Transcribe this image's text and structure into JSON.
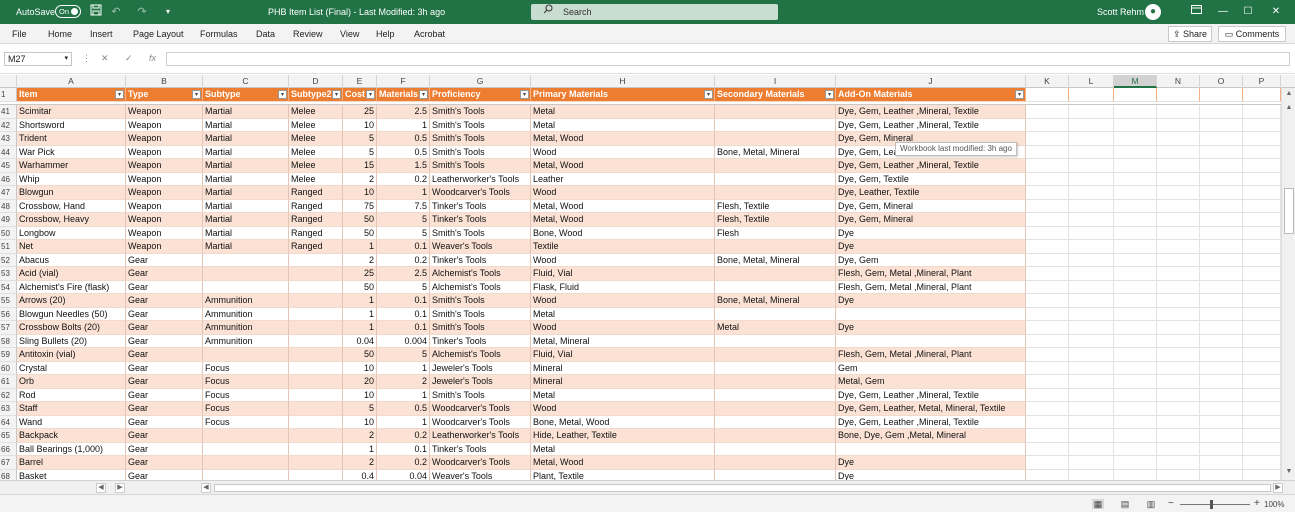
{
  "titlebar": {
    "autosave_label": "AutoSave",
    "autosave_state": "On",
    "title": "PHB Item List (Final)  -  Last Modified: 3h ago",
    "search_placeholder": "Search",
    "user_name": "Scott Rehm"
  },
  "ribbon": {
    "tabs": [
      "File",
      "Home",
      "Insert",
      "Page Layout",
      "Formulas",
      "Data",
      "Review",
      "View",
      "Help",
      "Acrobat"
    ],
    "share_label": "Share",
    "comments_label": "Comments"
  },
  "formula_bar": {
    "name_box": "M27",
    "fx_label": "fx",
    "value": ""
  },
  "columns": [
    "A",
    "B",
    "C",
    "D",
    "E",
    "F",
    "G",
    "H",
    "I",
    "J",
    "K",
    "L",
    "M",
    "N",
    "O",
    "P"
  ],
  "selected_column": "M",
  "header_row": {
    "row_number": "1",
    "cells": [
      "Item",
      "Type",
      "Subtype",
      "Subtype2",
      "Cost",
      "Materials",
      "Proficiency",
      "Primary Materials",
      "Secondary Materials",
      "Add-On Materials"
    ]
  },
  "rows": [
    {
      "n": "41",
      "c": [
        "Scimitar",
        "Weapon",
        "Martial",
        "Melee",
        "25",
        "2.5",
        "Smith's Tools",
        "Metal",
        "",
        "Dye, Gem, Leather ,Mineral, Textile"
      ]
    },
    {
      "n": "42",
      "c": [
        "Shortsword",
        "Weapon",
        "Martial",
        "Melee",
        "10",
        "1",
        "Smith's Tools",
        "Metal",
        "",
        "Dye, Gem, Leather ,Mineral, Textile"
      ]
    },
    {
      "n": "43",
      "c": [
        "Trident",
        "Weapon",
        "Martial",
        "Melee",
        "5",
        "0.5",
        "Smith's Tools",
        "Metal, Wood",
        "",
        "Dye, Gem, Mineral"
      ]
    },
    {
      "n": "44",
      "c": [
        "War Pick",
        "Weapon",
        "Martial",
        "Melee",
        "5",
        "0.5",
        "Smith's Tools",
        "Wood",
        "Bone, Metal, Mineral",
        "Dye, Gem, Lea"
      ]
    },
    {
      "n": "45",
      "c": [
        "Warhammer",
        "Weapon",
        "Martial",
        "Melee",
        "15",
        "1.5",
        "Smith's Tools",
        "Metal, Wood",
        "",
        "Dye, Gem, Leather ,Mineral, Textile"
      ]
    },
    {
      "n": "46",
      "c": [
        "Whip",
        "Weapon",
        "Martial",
        "Melee",
        "2",
        "0.2",
        "Leatherworker's Tools",
        "Leather",
        "",
        "Dye, Gem, Textile"
      ]
    },
    {
      "n": "47",
      "c": [
        "Blowgun",
        "Weapon",
        "Martial",
        "Ranged",
        "10",
        "1",
        "Woodcarver's Tools",
        "Wood",
        "",
        "Dye, Leather, Textile"
      ]
    },
    {
      "n": "48",
      "c": [
        "Crossbow, Hand",
        "Weapon",
        "Martial",
        "Ranged",
        "75",
        "7.5",
        "Tinker's Tools",
        "Metal, Wood",
        "Flesh, Textile",
        "Dye, Gem, Mineral"
      ]
    },
    {
      "n": "49",
      "c": [
        "Crossbow, Heavy",
        "Weapon",
        "Martial",
        "Ranged",
        "50",
        "5",
        "Tinker's Tools",
        "Metal, Wood",
        "Flesh, Textile",
        "Dye, Gem, Mineral"
      ]
    },
    {
      "n": "50",
      "c": [
        "Longbow",
        "Weapon",
        "Martial",
        "Ranged",
        "50",
        "5",
        "Smith's Tools",
        "Bone, Wood",
        "Flesh",
        "Dye"
      ]
    },
    {
      "n": "51",
      "c": [
        "Net",
        "Weapon",
        "Martial",
        "Ranged",
        "1",
        "0.1",
        "Weaver's Tools",
        "Textile",
        "",
        "Dye"
      ]
    },
    {
      "n": "52",
      "c": [
        "Abacus",
        "Gear",
        "",
        "",
        "2",
        "0.2",
        "Tinker's Tools",
        "Wood",
        "Bone, Metal, Mineral",
        "Dye, Gem"
      ]
    },
    {
      "n": "53",
      "c": [
        "Acid (vial)",
        "Gear",
        "",
        "",
        "25",
        "2.5",
        "Alchemist's Tools",
        "Fluid, Vial",
        "",
        "Flesh, Gem, Metal ,Mineral, Plant"
      ]
    },
    {
      "n": "54",
      "c": [
        "Alchemist's Fire (flask)",
        "Gear",
        "",
        "",
        "50",
        "5",
        "Alchemist's Tools",
        "Flask, Fluid",
        "",
        "Flesh, Gem, Metal ,Mineral, Plant"
      ]
    },
    {
      "n": "55",
      "c": [
        "Arrows (20)",
        "Gear",
        "Ammunition",
        "",
        "1",
        "0.1",
        "Smith's Tools",
        "Wood",
        "Bone, Metal, Mineral",
        "Dye"
      ]
    },
    {
      "n": "56",
      "c": [
        "Blowgun Needles (50)",
        "Gear",
        "Ammunition",
        "",
        "1",
        "0.1",
        "Smith's Tools",
        "Metal",
        "",
        ""
      ]
    },
    {
      "n": "57",
      "c": [
        "Crossbow Bolts (20)",
        "Gear",
        "Ammunition",
        "",
        "1",
        "0.1",
        "Smith's Tools",
        "Wood",
        "Metal",
        "Dye"
      ]
    },
    {
      "n": "58",
      "c": [
        "Sling Bullets (20)",
        "Gear",
        "Ammunition",
        "",
        "0.04",
        "0.004",
        "Tinker's Tools",
        "Metal, Mineral",
        "",
        ""
      ]
    },
    {
      "n": "59",
      "c": [
        "Antitoxin (vial)",
        "Gear",
        "",
        "",
        "50",
        "5",
        "Alchemist's Tools",
        "Fluid, Vial",
        "",
        "Flesh, Gem, Metal ,Mineral, Plant"
      ]
    },
    {
      "n": "60",
      "c": [
        "Crystal",
        "Gear",
        "Focus",
        "",
        "10",
        "1",
        "Jeweler's Tools",
        "Mineral",
        "",
        "Gem"
      ]
    },
    {
      "n": "61",
      "c": [
        "Orb",
        "Gear",
        "Focus",
        "",
        "20",
        "2",
        "Jeweler's Tools",
        "Mineral",
        "",
        "Metal, Gem"
      ]
    },
    {
      "n": "62",
      "c": [
        "Rod",
        "Gear",
        "Focus",
        "",
        "10",
        "1",
        "Smith's Tools",
        "Metal",
        "",
        "Dye, Gem, Leather ,Mineral, Textile"
      ]
    },
    {
      "n": "63",
      "c": [
        "Staff",
        "Gear",
        "Focus",
        "",
        "5",
        "0.5",
        "Woodcarver's Tools",
        "Wood",
        "",
        "Dye, Gem, Leather, Metal, Mineral, Textile"
      ]
    },
    {
      "n": "64",
      "c": [
        "Wand",
        "Gear",
        "Focus",
        "",
        "10",
        "1",
        "Woodcarver's Tools",
        "Bone, Metal, Wood",
        "",
        "Dye, Gem, Leather ,Mineral, Textile"
      ]
    },
    {
      "n": "65",
      "c": [
        "Backpack",
        "Gear",
        "",
        "",
        "2",
        "0.2",
        "Leatherworker's Tools",
        "Hide, Leather, Textile",
        "",
        "Bone, Dye, Gem ,Metal, Mineral"
      ]
    },
    {
      "n": "66",
      "c": [
        "Ball Bearings (1,000)",
        "Gear",
        "",
        "",
        "1",
        "0.1",
        "Tinker's Tools",
        "Metal",
        "",
        ""
      ]
    },
    {
      "n": "67",
      "c": [
        "Barrel",
        "Gear",
        "",
        "",
        "2",
        "0.2",
        "Woodcarver's Tools",
        "Metal, Wood",
        "",
        "Dye"
      ]
    },
    {
      "n": "68",
      "c": [
        "Basket",
        "Gear",
        "",
        "",
        "0.4",
        "0.04",
        "Weaver's Tools",
        "Plant, Textile",
        "",
        "Dye"
      ]
    }
  ],
  "tooltip": "Workbook last modified: 3h ago",
  "statusbar": {
    "zoom_minus": "−",
    "zoom_plus": "+",
    "zoom_level": "100%"
  },
  "colors": {
    "excel_green": "#217346",
    "table_header": "#ed7d31",
    "band_row": "#fbe2d5"
  },
  "icons": [
    "save-icon",
    "undo-icon",
    "redo-icon",
    "customize-qat-icon",
    "search-icon",
    "avatar-icon",
    "ribbon-display-icon",
    "minimize-icon",
    "maximize-icon",
    "close-icon",
    "share-icon",
    "comments-icon",
    "filter-dropdown-icon",
    "cancel-icon",
    "enter-icon",
    "function-icon",
    "normal-view-icon",
    "page-layout-view-icon",
    "page-break-view-icon"
  ]
}
